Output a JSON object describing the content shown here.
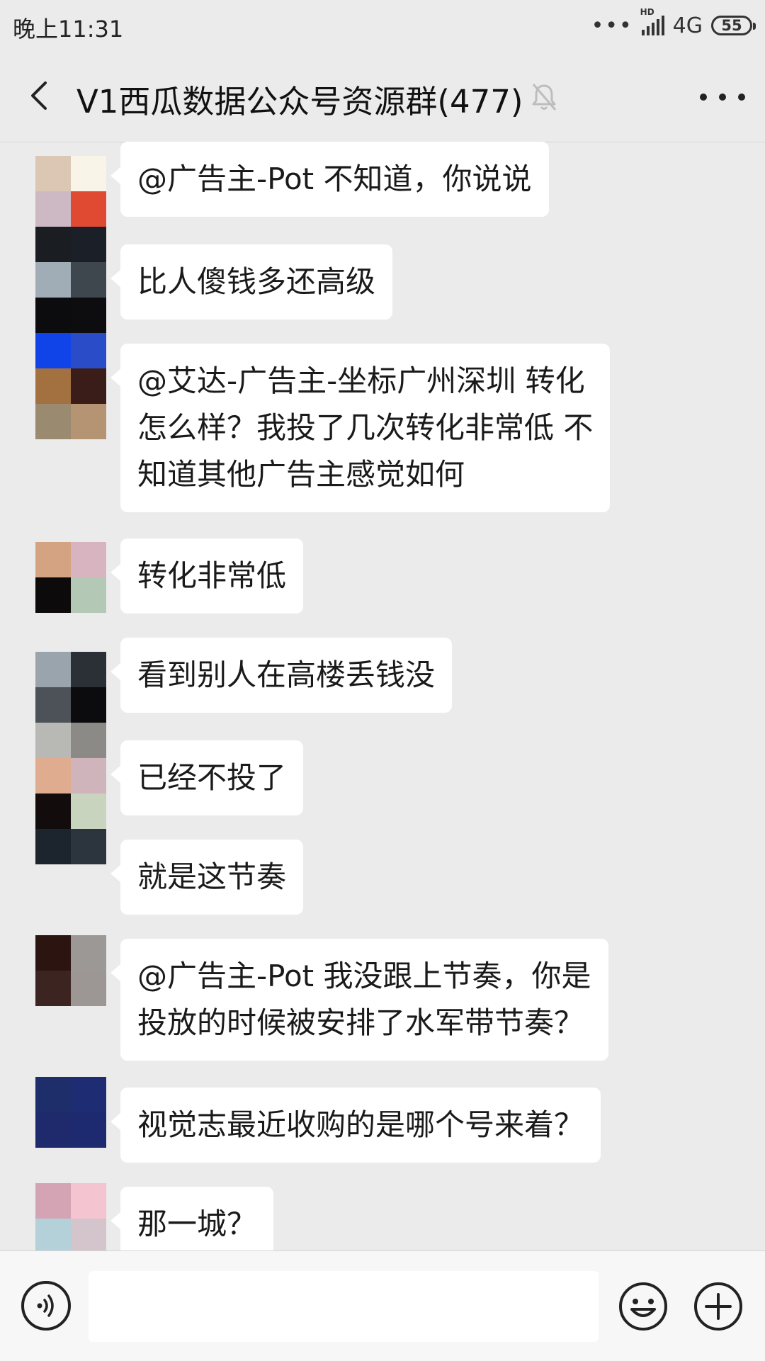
{
  "status_bar": {
    "time": "晚上11:31",
    "dots": "•••",
    "hd": "HD",
    "network": "4G",
    "battery": "55"
  },
  "header": {
    "title": "V1西瓜数据公众号资源群(477)"
  },
  "messages": [
    {
      "lines": [
        "@广告主-Pot 不知道，你说说"
      ]
    },
    {
      "lines": [
        "比人傻钱多还高级"
      ]
    },
    {
      "lines": [
        "@艾达-广告主-坐标广州深圳 转化",
        "怎么样？我投了几次转化非常低 不",
        "知道其他广告主感觉如何"
      ]
    },
    {
      "lines": [
        "转化非常低"
      ]
    },
    {
      "lines": [
        "看到别人在高楼丢钱没"
      ]
    },
    {
      "lines": [
        "已经不投了"
      ]
    },
    {
      "lines": [
        "就是这节奏"
      ]
    },
    {
      "lines": [
        "@广告主-Pot 我没跟上节奏，你是",
        "投放的时候被安排了水军带节奏？"
      ]
    },
    {
      "lines": [
        "视觉志最近收购的是哪个号来着？"
      ]
    },
    {
      "lines": [
        "那一城？"
      ]
    }
  ],
  "colors": {
    "background": "#ebebeb",
    "bubble": "#ffffff",
    "avatar_tiles": [
      [
        "#dcc6b4",
        "#f8f4e8",
        "#cdb9c4",
        "#e14a32"
      ],
      [
        "#1a1d22",
        "#1a1f28",
        "#a0acb6",
        "#3e474e"
      ],
      [
        "#0c0c0e",
        "#0d0d10",
        "#1144e8",
        "#2a4cc8"
      ],
      [
        "#a3713f",
        "#3a1c18",
        "#9a8a70",
        "#b59474"
      ],
      [
        "#d4a482",
        "#d8b4c0",
        "#0c0a0a",
        "#b4c8b6"
      ],
      [
        "#9aa4ac",
        "#2a3036",
        "#4c5258",
        "#0c0c0e"
      ],
      [
        "#b8b8b4",
        "#8c8a86",
        "#e0ac90",
        "#d0b4bc"
      ],
      [
        "#120c0c",
        "#c8d4be",
        "#1c242e",
        "#2c343e"
      ],
      [
        "#2c1410",
        "#9c9896",
        "#3c2420",
        "#9c9694"
      ],
      [
        "#1e2e6a",
        "#1e2c74",
        "#1e2a6c",
        "#1e2a70"
      ],
      [
        "#d4a4b4",
        "#f4c4d0",
        "#b4d0d8",
        "#d4c4cc"
      ]
    ]
  }
}
